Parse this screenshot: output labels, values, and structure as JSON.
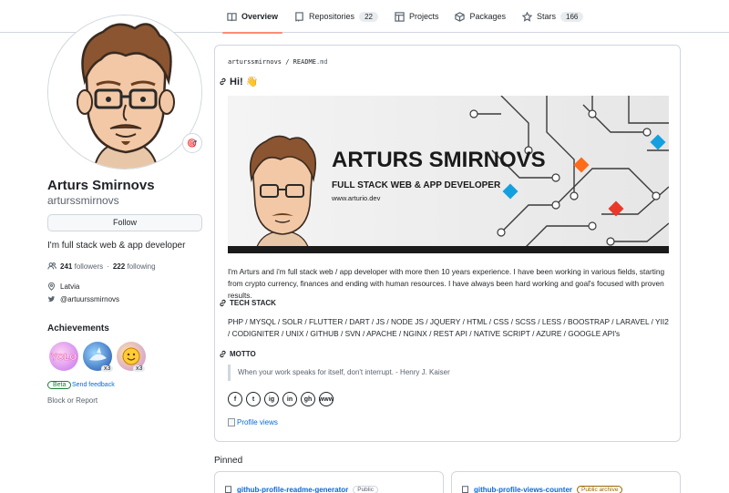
{
  "nav": {
    "tabs": [
      {
        "label": "Overview",
        "icon": "book-icon",
        "count": ""
      },
      {
        "label": "Repositories",
        "icon": "repo-icon",
        "count": "22"
      },
      {
        "label": "Projects",
        "icon": "table-icon",
        "count": ""
      },
      {
        "label": "Packages",
        "icon": "package-icon",
        "count": ""
      },
      {
        "label": "Stars",
        "icon": "star-icon",
        "count": "166"
      }
    ]
  },
  "profile": {
    "name": "Arturs Smirnovs",
    "login": "arturssmirnovs",
    "follow_label": "Follow",
    "bio": "I'm full stack web & app developer",
    "followers": "241",
    "followers_label": "followers",
    "separator": "·",
    "following": "222",
    "following_label": "following",
    "location": "Latvia",
    "twitter": "@artuurssmirnovs",
    "status_emoji": "🎯"
  },
  "achievements": {
    "title": "Achievements",
    "badges": [
      {
        "name": "YOLO",
        "count": ""
      },
      {
        "name": "Pull Shark",
        "count": "x3"
      },
      {
        "name": "Quickdraw",
        "count": "x3"
      }
    ],
    "beta_label": "Beta",
    "feedback_label": "Send feedback",
    "block_label": "Block or Report"
  },
  "readme": {
    "path_user": "arturssmirnovs",
    "path_sep": "/",
    "path_file": "README",
    "path_ext": ".md",
    "greeting": "Hi! 👋",
    "banner": {
      "title": "ARTURS SMIRNOVS",
      "subtitle": "FULL STACK WEB & APP DEVELOPER",
      "url": "www.arturio.dev"
    },
    "intro": "I'm Arturs and i'm full stack web / app developer with more then 10 years experience. I have been working in various fields, starting from crypto currency, finances and ending with human resources. I have always been hard working and goal's focused with proven results.",
    "tech_heading": "TECH STACK",
    "tech_list": "PHP / MYSQL / SOLR / FLUTTER / DART / JS / NODE JS / JQUERY / HTML / CSS / SCSS / LESS / BOOSTRAP / LARAVEL / YII2 / CODIGNITER / UNIX / GITHUB / SVN / APACHE / NGINX / REST API / NATIVE SCRIPT / AZURE / GOOGLE API's",
    "motto_heading": "MOTTO",
    "motto": "When your work speaks for itself, don't interrupt. - Henry J. Kaiser",
    "socials": [
      "f",
      "t",
      "ig",
      "in",
      "gh",
      "www"
    ],
    "profile_views": "Profile views"
  },
  "pinned": {
    "title": "Pinned",
    "repos": [
      {
        "name": "github-profile-readme-generator",
        "visibility": "Public"
      },
      {
        "name": "github-profile-views-counter",
        "visibility": "Public archive"
      }
    ]
  },
  "colors": {
    "accent": "#fd8c73",
    "link": "#0969da",
    "border": "#d0d7de",
    "banner_orange": "#ff6b1a",
    "banner_blue": "#14a0e0",
    "banner_red": "#e8392b"
  }
}
